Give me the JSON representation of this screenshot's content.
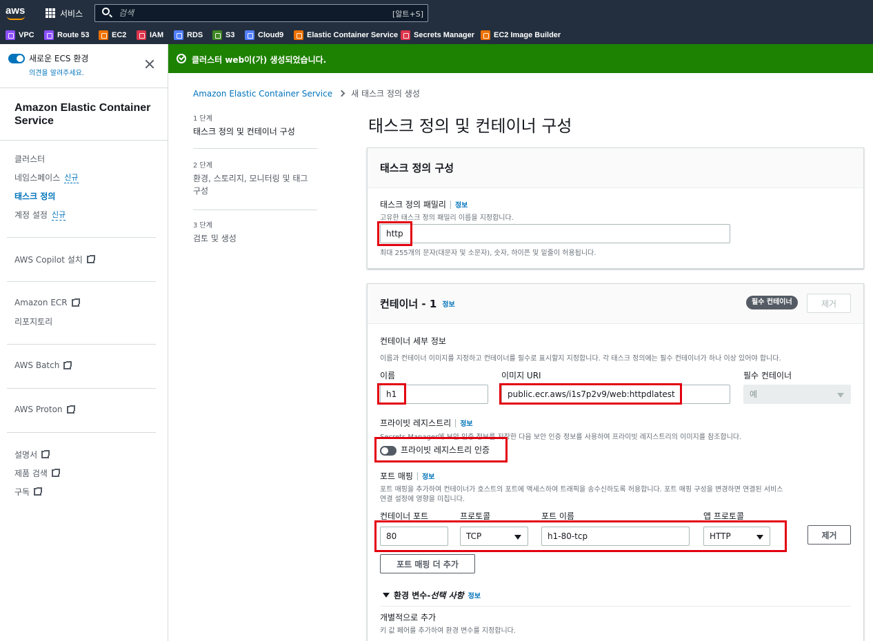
{
  "topnav": {
    "logo": "aws",
    "services_label": "서비스",
    "search_placeholder": "검색",
    "search_shortcut": "[알트+S]"
  },
  "favorites": [
    {
      "label": "VPC",
      "color": "#8c4fff"
    },
    {
      "label": "Route 53",
      "color": "#8c4fff"
    },
    {
      "label": "EC2",
      "color": "#ed7100"
    },
    {
      "label": "IAM",
      "color": "#dd344c"
    },
    {
      "label": "RDS",
      "color": "#527fff"
    },
    {
      "label": "S3",
      "color": "#3f8624"
    },
    {
      "label": "Cloud9",
      "color": "#527fff"
    },
    {
      "label": "Elastic Container Service",
      "color": "#ed7100"
    },
    {
      "label": "Secrets Manager",
      "color": "#dd344c"
    },
    {
      "label": "EC2 Image Builder",
      "color": "#ed7100"
    }
  ],
  "sidebar": {
    "new_ecs_label": "새로운 ECS 환경",
    "feedback_link": "의견을 알려주세요.",
    "title": "Amazon Elastic Container Service",
    "items": [
      {
        "label": "클러스터"
      },
      {
        "label": "네임스페이스",
        "badge": "신규"
      },
      {
        "label": "태스크 정의",
        "active": true
      },
      {
        "label": "계정 설정",
        "badge": "신규"
      }
    ],
    "links": [
      {
        "label": "AWS Copilot 설치"
      },
      {
        "label": "Amazon ECR"
      },
      {
        "label": "리포지토리"
      },
      {
        "label": "AWS Batch"
      },
      {
        "label": "AWS Proton"
      },
      {
        "label": "설명서"
      },
      {
        "label": "제품 검색"
      },
      {
        "label": "구독"
      }
    ]
  },
  "flash": {
    "message": "클러스터 web이(가) 생성되었습니다.",
    "color": "#1d8102"
  },
  "breadcrumb": {
    "root": "Amazon Elastic Container Service",
    "current": "새 태스크 정의 생성"
  },
  "steps": [
    {
      "num": "1 단계",
      "label": "태스크 정의 및 컨테이너 구성"
    },
    {
      "num": "2 단계",
      "label": "환경, 스토리지, 모니터링 및 태그 구성"
    },
    {
      "num": "3 단계",
      "label": "검토 및 생성"
    }
  ],
  "page_title": "태스크 정의 및 컨테이너 구성",
  "task_def_panel": {
    "header": "태스크 정의 구성",
    "family_label": "태스크 정의 패밀리",
    "info": "정보",
    "family_desc": "고유한 태스크 정의 패밀리 이름을 지정합니다.",
    "family_value": "http",
    "family_hint": "최대 255개의 문자(대문자 및 소문자), 숫자, 하이픈 및 밑줄이 허용됩니다."
  },
  "container_panel": {
    "header": "컨테이너 - 1",
    "info": "정보",
    "essential_badge": "필수 컨테이너",
    "remove_label": "제거",
    "details_label": "컨테이너 세부 정보",
    "details_desc": "이름과 컨테이너 이미지를 지정하고 컨테이너를 필수로 표시할지 지정합니다. 각 태스크 정의에는 필수 컨테이너가 하나 이상 있어야 합니다.",
    "name_label": "이름",
    "name_value": "h1",
    "image_label": "이미지 URI",
    "image_value": "public.ecr.aws/i1s7p2v9/web:httpdlatest",
    "essential_label": "필수 컨테이너",
    "essential_value": "예",
    "private_registry_label": "프라이빗 레지스트리",
    "private_registry_desc": "Secrets Manager에 보안 인증 정보를 저장한 다음 보안 인증 정보를 사용하여 프라이빗 레지스트리의 이미지를 참조합니다.",
    "private_registry_toggle": "프라이빗 레지스트리 인증",
    "port_mapping_label": "포트 매핑",
    "port_mapping_desc_1": "포트 매핑을 추가하여 컨테이너가 호스트의 포트에 액세스하여 트래픽을 송수신하도록 허용합니다. 포트 매핑 구성을 변경하면 연결된 서비스",
    "port_mapping_desc_2": "연결 설정에 영향을 미칩니다.",
    "col_container_port": "컨테이너 포트",
    "col_protocol": "프로토콜",
    "col_port_name": "포트 이름",
    "col_app_protocol": "앱 프로토콜",
    "container_port": "80",
    "protocol": "TCP",
    "port_name": "h1-80-tcp",
    "app_protocol": "HTTP",
    "port_remove": "제거",
    "add_port_mapping": "포트 매핑 더 추가",
    "env_label": "환경 변수",
    "env_optional": "선택 사항",
    "env_dash": " - ",
    "add_individually": "개별적으로 추가",
    "add_individually_desc": "키 값 페어를 추가하여 환경 변수를 지정합니다."
  }
}
